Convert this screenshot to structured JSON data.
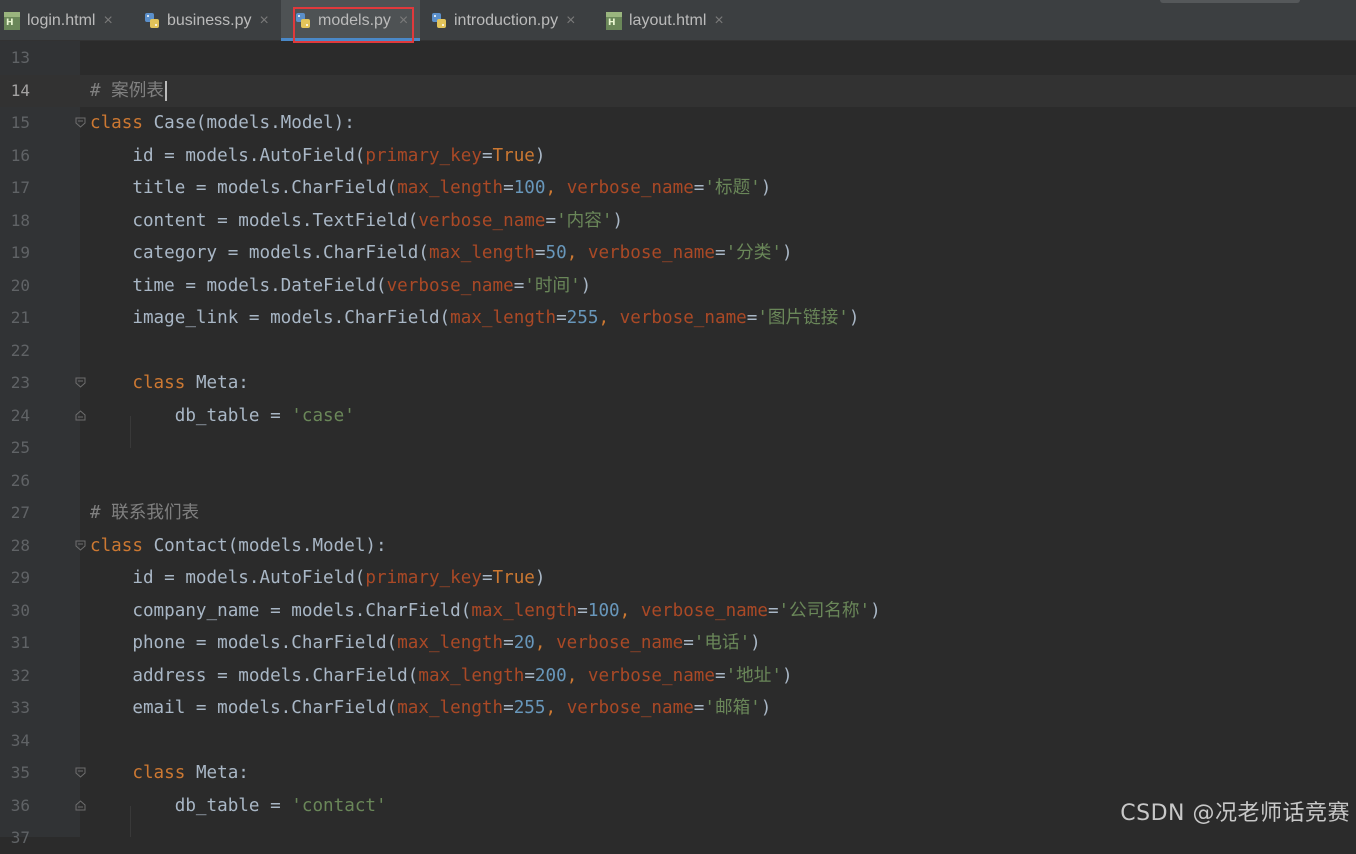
{
  "tabs": [
    {
      "label": "login.html",
      "type": "html",
      "active": false
    },
    {
      "label": "business.py",
      "type": "python",
      "active": false
    },
    {
      "label": "models.py",
      "type": "python",
      "active": true
    },
    {
      "label": "introduction.py",
      "type": "python",
      "active": false
    },
    {
      "label": "layout.html",
      "type": "html",
      "active": false
    }
  ],
  "editor": {
    "current_line": 14,
    "lines": [
      {
        "n": "13",
        "tokens": []
      },
      {
        "n": "14",
        "tokens": [
          {
            "t": "cmt",
            "v": "# 案例表"
          }
        ]
      },
      {
        "n": "15",
        "tokens": [
          {
            "t": "kw",
            "v": "class "
          },
          {
            "t": "p",
            "v": "Case(models.Model):"
          }
        ]
      },
      {
        "n": "16",
        "tokens": [
          {
            "t": "p",
            "v": "    id = models.AutoField("
          },
          {
            "t": "param",
            "v": "primary_key"
          },
          {
            "t": "p",
            "v": "="
          },
          {
            "t": "kw",
            "v": "True"
          },
          {
            "t": "p",
            "v": ")"
          }
        ]
      },
      {
        "n": "17",
        "tokens": [
          {
            "t": "p",
            "v": "    title = models.CharField("
          },
          {
            "t": "param",
            "v": "max_length"
          },
          {
            "t": "p",
            "v": "="
          },
          {
            "t": "num",
            "v": "100"
          },
          {
            "t": "comma",
            "v": ", "
          },
          {
            "t": "param",
            "v": "verbose_name"
          },
          {
            "t": "p",
            "v": "="
          },
          {
            "t": "str",
            "v": "'标题'"
          },
          {
            "t": "p",
            "v": ")"
          }
        ]
      },
      {
        "n": "18",
        "tokens": [
          {
            "t": "p",
            "v": "    content = models.TextField("
          },
          {
            "t": "param",
            "v": "verbose_name"
          },
          {
            "t": "p",
            "v": "="
          },
          {
            "t": "str",
            "v": "'内容'"
          },
          {
            "t": "p",
            "v": ")"
          }
        ]
      },
      {
        "n": "19",
        "tokens": [
          {
            "t": "p",
            "v": "    category = models.CharField("
          },
          {
            "t": "param",
            "v": "max_length"
          },
          {
            "t": "p",
            "v": "="
          },
          {
            "t": "num",
            "v": "50"
          },
          {
            "t": "comma",
            "v": ", "
          },
          {
            "t": "param",
            "v": "verbose_name"
          },
          {
            "t": "p",
            "v": "="
          },
          {
            "t": "str",
            "v": "'分类'"
          },
          {
            "t": "p",
            "v": ")"
          }
        ]
      },
      {
        "n": "20",
        "tokens": [
          {
            "t": "p",
            "v": "    time = models.DateField("
          },
          {
            "t": "param",
            "v": "verbose_name"
          },
          {
            "t": "p",
            "v": "="
          },
          {
            "t": "str",
            "v": "'时间'"
          },
          {
            "t": "p",
            "v": ")"
          }
        ]
      },
      {
        "n": "21",
        "tokens": [
          {
            "t": "p",
            "v": "    image_link = models.CharField("
          },
          {
            "t": "param",
            "v": "max_length"
          },
          {
            "t": "p",
            "v": "="
          },
          {
            "t": "num",
            "v": "255"
          },
          {
            "t": "comma",
            "v": ", "
          },
          {
            "t": "param",
            "v": "verbose_name"
          },
          {
            "t": "p",
            "v": "="
          },
          {
            "t": "str",
            "v": "'图片链接'"
          },
          {
            "t": "p",
            "v": ")"
          }
        ]
      },
      {
        "n": "22",
        "tokens": []
      },
      {
        "n": "23",
        "tokens": [
          {
            "t": "p",
            "v": "    "
          },
          {
            "t": "kw",
            "v": "class "
          },
          {
            "t": "p",
            "v": "Meta:"
          }
        ]
      },
      {
        "n": "24",
        "tokens": [
          {
            "t": "p",
            "v": "        db_table = "
          },
          {
            "t": "str",
            "v": "'case'"
          }
        ]
      },
      {
        "n": "25",
        "tokens": []
      },
      {
        "n": "26",
        "tokens": []
      },
      {
        "n": "27",
        "tokens": [
          {
            "t": "cmt",
            "v": "# 联系我们表"
          }
        ]
      },
      {
        "n": "28",
        "tokens": [
          {
            "t": "kw",
            "v": "class "
          },
          {
            "t": "p",
            "v": "Contact(models.Model):"
          }
        ]
      },
      {
        "n": "29",
        "tokens": [
          {
            "t": "p",
            "v": "    id = models.AutoField("
          },
          {
            "t": "param",
            "v": "primary_key"
          },
          {
            "t": "p",
            "v": "="
          },
          {
            "t": "kw",
            "v": "True"
          },
          {
            "t": "p",
            "v": ")"
          }
        ]
      },
      {
        "n": "30",
        "tokens": [
          {
            "t": "p",
            "v": "    company_name = models.CharField("
          },
          {
            "t": "param",
            "v": "max_length"
          },
          {
            "t": "p",
            "v": "="
          },
          {
            "t": "num",
            "v": "100"
          },
          {
            "t": "comma",
            "v": ", "
          },
          {
            "t": "param",
            "v": "verbose_name"
          },
          {
            "t": "p",
            "v": "="
          },
          {
            "t": "str",
            "v": "'公司名称'"
          },
          {
            "t": "p",
            "v": ")"
          }
        ]
      },
      {
        "n": "31",
        "tokens": [
          {
            "t": "p",
            "v": "    phone = models.CharField("
          },
          {
            "t": "param",
            "v": "max_length"
          },
          {
            "t": "p",
            "v": "="
          },
          {
            "t": "num",
            "v": "20"
          },
          {
            "t": "comma",
            "v": ", "
          },
          {
            "t": "param",
            "v": "verbose_name"
          },
          {
            "t": "p",
            "v": "="
          },
          {
            "t": "str",
            "v": "'电话'"
          },
          {
            "t": "p",
            "v": ")"
          }
        ]
      },
      {
        "n": "32",
        "tokens": [
          {
            "t": "p",
            "v": "    address = models.CharField("
          },
          {
            "t": "param",
            "v": "max_length"
          },
          {
            "t": "p",
            "v": "="
          },
          {
            "t": "num",
            "v": "200"
          },
          {
            "t": "comma",
            "v": ", "
          },
          {
            "t": "param",
            "v": "verbose_name"
          },
          {
            "t": "p",
            "v": "="
          },
          {
            "t": "str",
            "v": "'地址'"
          },
          {
            "t": "p",
            "v": ")"
          }
        ]
      },
      {
        "n": "33",
        "tokens": [
          {
            "t": "p",
            "v": "    email = models.CharField("
          },
          {
            "t": "param",
            "v": "max_length"
          },
          {
            "t": "p",
            "v": "="
          },
          {
            "t": "num",
            "v": "255"
          },
          {
            "t": "comma",
            "v": ", "
          },
          {
            "t": "param",
            "v": "verbose_name"
          },
          {
            "t": "p",
            "v": "="
          },
          {
            "t": "str",
            "v": "'邮箱'"
          },
          {
            "t": "p",
            "v": ")"
          }
        ]
      },
      {
        "n": "34",
        "tokens": []
      },
      {
        "n": "35",
        "tokens": [
          {
            "t": "p",
            "v": "    "
          },
          {
            "t": "kw",
            "v": "class "
          },
          {
            "t": "p",
            "v": "Meta:"
          }
        ]
      },
      {
        "n": "36",
        "tokens": [
          {
            "t": "p",
            "v": "        db_table = "
          },
          {
            "t": "str",
            "v": "'contact'"
          }
        ]
      },
      {
        "n": "37",
        "tokens": []
      }
    ]
  },
  "colors": {
    "keyword": "#cc7832",
    "param": "#aa4926",
    "number": "#6897bb",
    "string": "#6a8759",
    "comment": "#808080",
    "text": "#a9b7c6",
    "highlight_box": "#e0393c"
  },
  "watermark": "CSDN @况老师话竞赛"
}
